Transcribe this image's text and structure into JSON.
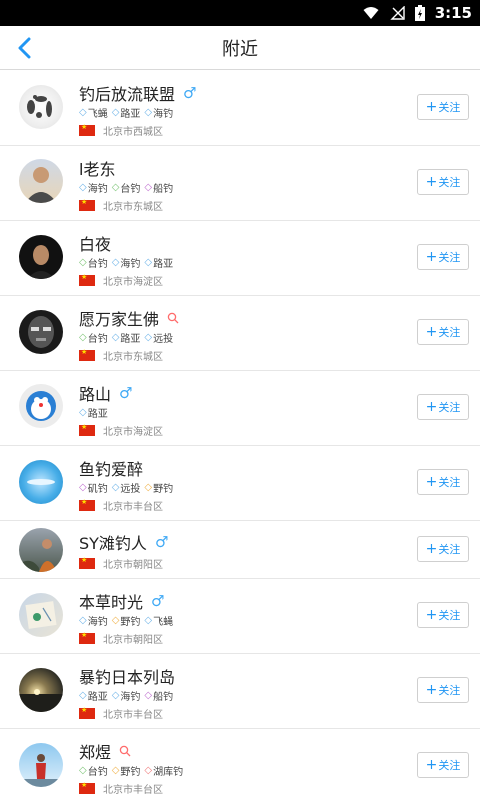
{
  "status": {
    "time": "3:15"
  },
  "header": {
    "title": "附近"
  },
  "colors": {
    "accent": "#2196f3",
    "male": "#3fa9f5",
    "female_search": "#ff6b6b"
  },
  "users": [
    {
      "name": "钓后放流联盟",
      "icon": "male",
      "tags": [
        {
          "label": "飞蝇",
          "color": "#6fb4e8"
        },
        {
          "label": "路亚",
          "color": "#6fb4e8"
        },
        {
          "label": "海钓",
          "color": "#6fb4e8"
        }
      ],
      "location": "北京市西城区",
      "follow": "关注"
    },
    {
      "name": "l老东",
      "icon": "",
      "tags": [
        {
          "label": "海钓",
          "color": "#6fb4e8"
        },
        {
          "label": "台钓",
          "color": "#7cc576"
        },
        {
          "label": "船钓",
          "color": "#c06fd0"
        }
      ],
      "location": "北京市东城区",
      "follow": "关注"
    },
    {
      "name": "白夜",
      "icon": "",
      "tags": [
        {
          "label": "台钓",
          "color": "#7cc576"
        },
        {
          "label": "海钓",
          "color": "#6fb4e8"
        },
        {
          "label": "路亚",
          "color": "#6fb4e8"
        }
      ],
      "location": "北京市海淀区",
      "follow": "关注"
    },
    {
      "name": "愿万家生佛",
      "icon": "search",
      "tags": [
        {
          "label": "台钓",
          "color": "#7cc576"
        },
        {
          "label": "路亚",
          "color": "#6fb4e8"
        },
        {
          "label": "远投",
          "color": "#6fb4e8"
        }
      ],
      "location": "北京市东城区",
      "follow": "关注"
    },
    {
      "name": "路山",
      "icon": "male",
      "tags": [
        {
          "label": "路亚",
          "color": "#6fb4e8"
        }
      ],
      "location": "北京市海淀区",
      "follow": "关注"
    },
    {
      "name": "鱼钓爱醉",
      "icon": "",
      "tags": [
        {
          "label": "矶钓",
          "color": "#c06fd0"
        },
        {
          "label": "远投",
          "color": "#6fb4e8"
        },
        {
          "label": "野钓",
          "color": "#f0b24a"
        }
      ],
      "location": "北京市丰台区",
      "follow": "关注"
    },
    {
      "name": "SY滩钓人",
      "icon": "male",
      "tags": [],
      "location": "北京市朝阳区",
      "follow": "关注"
    },
    {
      "name": "本草时光",
      "icon": "male",
      "tags": [
        {
          "label": "海钓",
          "color": "#6fb4e8"
        },
        {
          "label": "野钓",
          "color": "#f0b24a"
        },
        {
          "label": "飞蝇",
          "color": "#6fb4e8"
        }
      ],
      "location": "北京市朝阳区",
      "follow": "关注"
    },
    {
      "name": "暴钓日本列岛",
      "icon": "",
      "tags": [
        {
          "label": "路亚",
          "color": "#6fb4e8"
        },
        {
          "label": "海钓",
          "color": "#6fb4e8"
        },
        {
          "label": "船钓",
          "color": "#c06fd0"
        }
      ],
      "location": "北京市丰台区",
      "follow": "关注"
    },
    {
      "name": "郑煜",
      "icon": "search",
      "tags": [
        {
          "label": "台钓",
          "color": "#7cc576"
        },
        {
          "label": "野钓",
          "color": "#f0b24a"
        },
        {
          "label": "湖库钓",
          "color": "#ef7a7a"
        }
      ],
      "location": "北京市丰台区",
      "follow": "关注"
    }
  ]
}
